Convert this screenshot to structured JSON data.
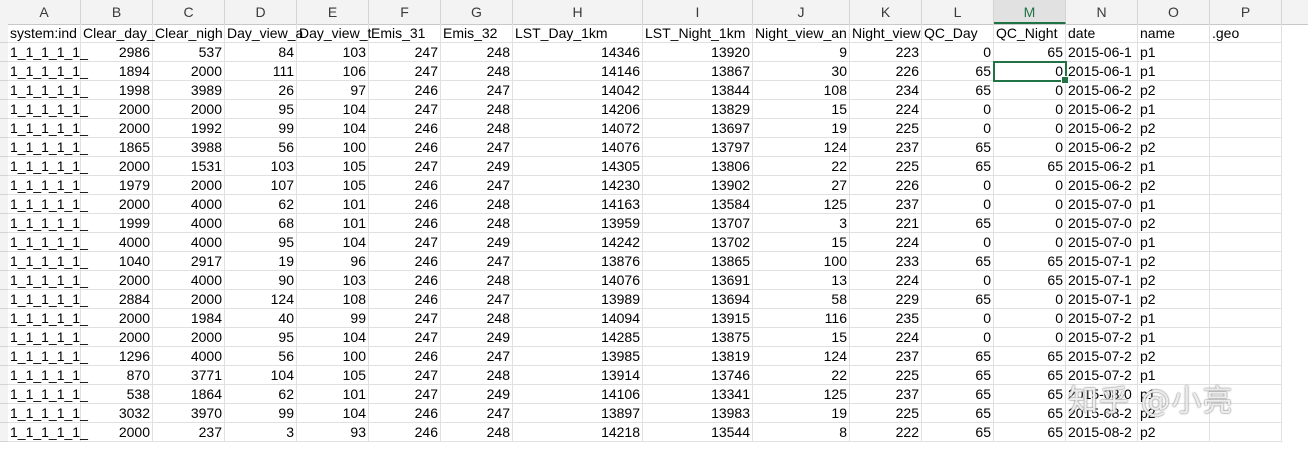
{
  "columns": [
    "A",
    "B",
    "C",
    "D",
    "E",
    "F",
    "G",
    "H",
    "I",
    "J",
    "K",
    "L",
    "M",
    "N",
    "O",
    "P"
  ],
  "selected_column": "M",
  "headers": [
    "system:ind",
    "Clear_day_",
    "Clear_nigh",
    "Day_view_a",
    "Day_view_t",
    "Emis_31",
    "Emis_32",
    "LST_Day_1km",
    "LST_Night_1km",
    "Night_view_an",
    "Night_view",
    "QC_Day",
    "QC_Night",
    "date",
    "name",
    ".geo"
  ],
  "rows": [
    [
      "1_1_1_1_1_",
      "2986",
      "537",
      "84",
      "103",
      "247",
      "248",
      "14346",
      "13920",
      "9",
      "223",
      "0",
      "65",
      "2015-06-1",
      "p1",
      ""
    ],
    [
      "1_1_1_1_1_",
      "1894",
      "2000",
      "111",
      "106",
      "247",
      "248",
      "14146",
      "13867",
      "30",
      "226",
      "65",
      "0",
      "2015-06-1",
      "p1",
      ""
    ],
    [
      "1_1_1_1_1_",
      "1998",
      "3989",
      "26",
      "97",
      "246",
      "247",
      "14042",
      "13844",
      "108",
      "234",
      "65",
      "0",
      "2015-06-2",
      "p2",
      ""
    ],
    [
      "1_1_1_1_1_",
      "2000",
      "2000",
      "95",
      "104",
      "247",
      "248",
      "14206",
      "13829",
      "15",
      "224",
      "0",
      "0",
      "2015-06-2",
      "p1",
      ""
    ],
    [
      "1_1_1_1_1_",
      "2000",
      "1992",
      "99",
      "104",
      "246",
      "248",
      "14072",
      "13697",
      "19",
      "225",
      "0",
      "0",
      "2015-06-2",
      "p2",
      ""
    ],
    [
      "1_1_1_1_1_",
      "1865",
      "3988",
      "56",
      "100",
      "246",
      "247",
      "14076",
      "13797",
      "124",
      "237",
      "65",
      "0",
      "2015-06-2",
      "p2",
      ""
    ],
    [
      "1_1_1_1_1_",
      "2000",
      "1531",
      "103",
      "105",
      "247",
      "249",
      "14305",
      "13806",
      "22",
      "225",
      "65",
      "65",
      "2015-06-2",
      "p1",
      ""
    ],
    [
      "1_1_1_1_1_",
      "1979",
      "2000",
      "107",
      "105",
      "246",
      "247",
      "14230",
      "13902",
      "27",
      "226",
      "0",
      "0",
      "2015-06-2",
      "p2",
      ""
    ],
    [
      "1_1_1_1_1_",
      "2000",
      "4000",
      "62",
      "101",
      "246",
      "248",
      "14163",
      "13584",
      "125",
      "237",
      "0",
      "0",
      "2015-07-0",
      "p1",
      ""
    ],
    [
      "1_1_1_1_1_",
      "1999",
      "4000",
      "68",
      "101",
      "246",
      "248",
      "13959",
      "13707",
      "3",
      "221",
      "65",
      "0",
      "2015-07-0",
      "p2",
      ""
    ],
    [
      "1_1_1_1_1_",
      "4000",
      "4000",
      "95",
      "104",
      "247",
      "249",
      "14242",
      "13702",
      "15",
      "224",
      "0",
      "0",
      "2015-07-0",
      "p1",
      ""
    ],
    [
      "1_1_1_1_1_",
      "1040",
      "2917",
      "19",
      "96",
      "246",
      "247",
      "13876",
      "13865",
      "100",
      "233",
      "65",
      "65",
      "2015-07-1",
      "p2",
      ""
    ],
    [
      "1_1_1_1_1_",
      "2000",
      "4000",
      "90",
      "103",
      "246",
      "248",
      "14076",
      "13691",
      "13",
      "224",
      "0",
      "65",
      "2015-07-1",
      "p2",
      ""
    ],
    [
      "1_1_1_1_1_",
      "2884",
      "2000",
      "124",
      "108",
      "246",
      "247",
      "13989",
      "13694",
      "58",
      "229",
      "65",
      "0",
      "2015-07-1",
      "p2",
      ""
    ],
    [
      "1_1_1_1_1_",
      "2000",
      "1984",
      "40",
      "99",
      "247",
      "248",
      "14094",
      "13915",
      "116",
      "235",
      "0",
      "0",
      "2015-07-2",
      "p1",
      ""
    ],
    [
      "1_1_1_1_1_",
      "2000",
      "2000",
      "95",
      "104",
      "247",
      "249",
      "14285",
      "13875",
      "15",
      "224",
      "0",
      "0",
      "2015-07-2",
      "p1",
      ""
    ],
    [
      "1_1_1_1_1_",
      "1296",
      "4000",
      "56",
      "100",
      "246",
      "247",
      "13985",
      "13819",
      "124",
      "237",
      "65",
      "65",
      "2015-07-2",
      "p2",
      ""
    ],
    [
      "1_1_1_1_1_",
      "870",
      "3771",
      "104",
      "105",
      "247",
      "248",
      "13914",
      "13746",
      "22",
      "225",
      "65",
      "65",
      "2015-07-2",
      "p1",
      ""
    ],
    [
      "1_1_1_1_1_",
      "538",
      "1864",
      "62",
      "101",
      "247",
      "249",
      "14106",
      "13341",
      "125",
      "237",
      "65",
      "65",
      "2015-08-0",
      "p1",
      ""
    ],
    [
      "1_1_1_1_1_",
      "3032",
      "3970",
      "99",
      "104",
      "246",
      "247",
      "13897",
      "13983",
      "19",
      "225",
      "65",
      "65",
      "2015-08-2",
      "p2",
      ""
    ],
    [
      "1_1_1_1_1_",
      "2000",
      "237",
      "3",
      "93",
      "246",
      "248",
      "14218",
      "13544",
      "8",
      "222",
      "65",
      "65",
      "2015-08-2",
      "p2",
      ""
    ]
  ],
  "watermark": "知乎 @小亮"
}
